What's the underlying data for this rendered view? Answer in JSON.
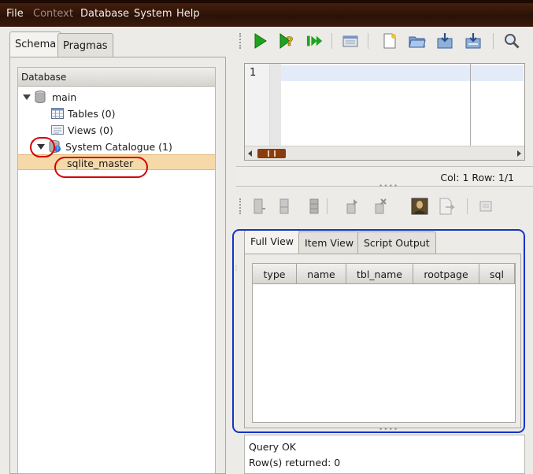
{
  "menu": [
    {
      "label": "File",
      "enabled": true
    },
    {
      "label": "Context",
      "enabled": false
    },
    {
      "label": "Database",
      "enabled": true
    },
    {
      "label": "System",
      "enabled": true
    },
    {
      "label": "Help",
      "enabled": true
    }
  ],
  "left_tabs": [
    {
      "label": "Schema",
      "active": true
    },
    {
      "label": "Pragmas",
      "active": false
    }
  ],
  "tree": {
    "header": "Database",
    "items": [
      {
        "label": "main",
        "icon": "database-icon",
        "expanded": true
      },
      {
        "label": "Tables (0)",
        "icon": "table-icon"
      },
      {
        "label": "Views (0)",
        "icon": "view-icon"
      },
      {
        "label": "System Catalogue (1)",
        "icon": "catalogue-icon",
        "expanded": true
      },
      {
        "label": "sqlite_master",
        "icon": "",
        "selected": true
      }
    ]
  },
  "toolbar_icons": [
    "run-icon",
    "explain-icon",
    "run-script-icon",
    "sql-history-icon",
    "new-file-icon",
    "open-file-icon",
    "save-file-icon",
    "save-as-icon",
    "search-icon"
  ],
  "editor": {
    "line_numbers": [
      "1"
    ],
    "status": "Col: 1 Row: 1/1"
  },
  "result_toolbar_icons": [
    "insert-row-icon",
    "commit-icon",
    "rollback-icon",
    "copy-row-icon",
    "delete-row-icon",
    "image-icon",
    "export-icon",
    "refresh-icon"
  ],
  "result_tabs": [
    {
      "label": "Full View",
      "active": true
    },
    {
      "label": "Item View",
      "active": false
    },
    {
      "label": "Script Output",
      "active": false
    }
  ],
  "columns": [
    "type",
    "name",
    "tbl_name",
    "rootpage",
    "sql"
  ],
  "messages": [
    "Query OK",
    "Row(s) returned: 0"
  ],
  "colors": {
    "annotation_red": "#d40000",
    "annotation_blue": "#1533c4",
    "selection": "#f6d9a8",
    "menubar": "#2b1206"
  }
}
